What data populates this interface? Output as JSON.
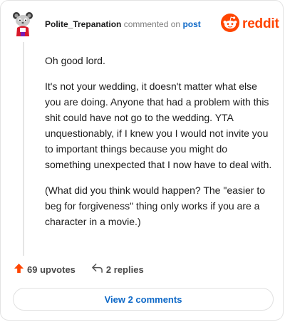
{
  "header": {
    "username": "Polite_Trepanation",
    "action_text": "commented on",
    "post_link": "post",
    "logo_text": "reddit"
  },
  "comment": {
    "paragraphs": [
      "Oh good lord.",
      "It's not your wedding, it doesn't matter what else you are doing. Anyone that had a problem with this shit could have not go to the wedding. YTA unquestionably, if I knew you I would not invite you to important things because you might do something unexpected that I now have to deal with.",
      "(What did you think would happen? The \"easier to beg for forgiveness\" thing only works if you are a character in a movie.)"
    ]
  },
  "actions": {
    "upvotes_label": "69 upvotes",
    "replies_label": "2 replies"
  },
  "footer": {
    "view_comments_label": "View 2 comments"
  },
  "colors": {
    "brand": "#ff4500",
    "link": "#0d68c7"
  },
  "icons": [
    "avatar",
    "reddit-logo-icon",
    "upvote-arrow-icon",
    "reply-arrow-icon"
  ]
}
